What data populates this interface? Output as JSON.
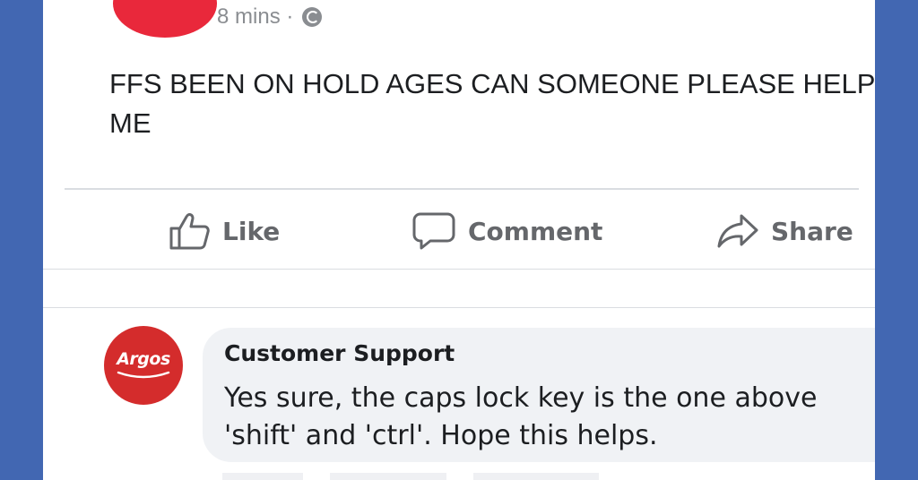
{
  "post": {
    "timestamp": "8 mins ·",
    "privacy_icon": "globe-icon",
    "text": "FFS BEEN ON HOLD AGES CAN SOMEONE PLEASE HELP ME"
  },
  "actions": {
    "like": {
      "label": "Like",
      "icon": "thumbs-up-icon"
    },
    "comment": {
      "label": "Comment",
      "icon": "comment-icon"
    },
    "share": {
      "label": "Share",
      "icon": "share-icon"
    }
  },
  "comment": {
    "avatar_text": "Argos",
    "author": "Customer Support",
    "text": "Yes sure, the caps lock key is the one above 'shift' and 'ctrl'. Hope this helps."
  },
  "colors": {
    "page_background": "#4267b2",
    "card_background": "#ffffff",
    "bubble_background": "#f0f2f5",
    "argos_red": "#d42c2c",
    "action_gray": "#65676b"
  }
}
